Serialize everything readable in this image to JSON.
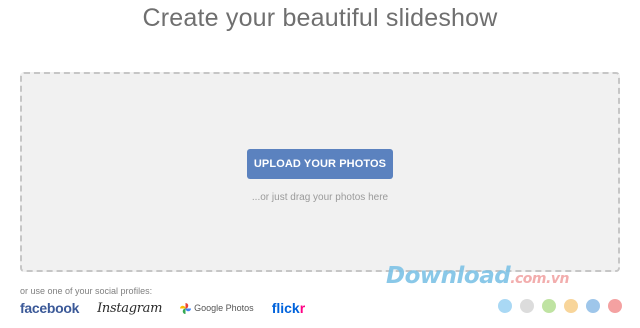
{
  "header": {
    "title": "Create your beautiful slideshow"
  },
  "dropzone": {
    "upload_label": "UPLOAD YOUR PHOTOS",
    "drag_hint": "...or just drag your photos here"
  },
  "social": {
    "label": "or use one of your social profiles:",
    "facebook": "facebook",
    "instagram": "Instagram",
    "google_photos": "Google Photos",
    "flickr_main": "flick",
    "flickr_r": "r"
  },
  "watermark": {
    "text": "Download",
    "domain": ".com.vn"
  },
  "color_dots": [
    "#a9d8f4",
    "#dcdcdc",
    "#bfe3a2",
    "#f8d59a",
    "#9ec6ea",
    "#f4a1a1"
  ]
}
